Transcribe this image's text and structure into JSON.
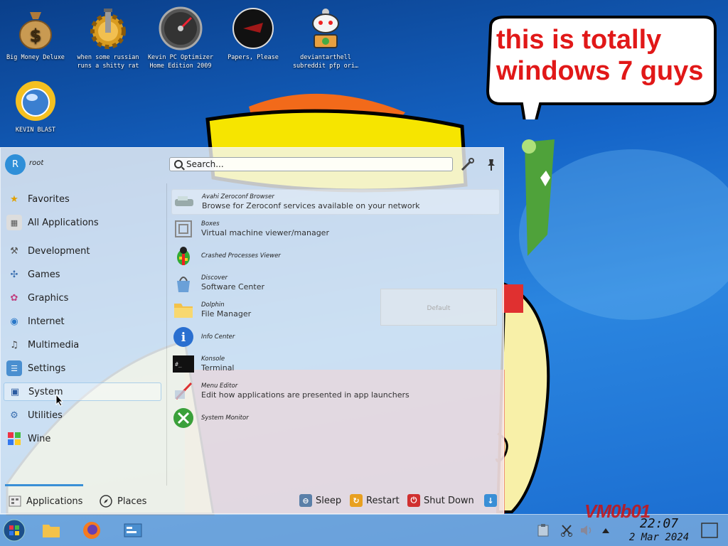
{
  "desktop": {
    "icons": [
      {
        "label": "Big Money Deluxe"
      },
      {
        "label": "when some russian runs a shitty rat"
      },
      {
        "label": "Kevin PC Optimizer Home Edition 2009"
      },
      {
        "label": "Papers, Please"
      },
      {
        "label": "deviantarthell subreddit pfp ori…"
      },
      {
        "label": "KEVIN BLAST"
      }
    ],
    "bubble_text": "this is totally windows 7 guys",
    "watermark": "VM0b01"
  },
  "menu": {
    "user": {
      "initial": "R",
      "name": "root"
    },
    "search": {
      "placeholder": "Search..."
    },
    "categories": [
      {
        "label": "Favorites",
        "icon": "star-icon"
      },
      {
        "label": "All Applications",
        "icon": "grid-icon"
      },
      {
        "label": "Development",
        "icon": "development-icon"
      },
      {
        "label": "Games",
        "icon": "games-icon"
      },
      {
        "label": "Graphics",
        "icon": "graphics-icon"
      },
      {
        "label": "Internet",
        "icon": "globe-icon"
      },
      {
        "label": "Multimedia",
        "icon": "multimedia-icon"
      },
      {
        "label": "Settings",
        "icon": "settings-icon"
      },
      {
        "label": "System",
        "icon": "system-icon",
        "selected": true
      },
      {
        "label": "Utilities",
        "icon": "utilities-icon"
      },
      {
        "label": "Wine",
        "icon": "wine-icon"
      }
    ],
    "apps": [
      {
        "name": "Avahi Zeroconf Browser",
        "desc": "Browse for Zeroconf services available on your network"
      },
      {
        "name": "Boxes",
        "desc": "Virtual machine viewer/manager"
      },
      {
        "name": "Crashed Processes Viewer",
        "desc": ""
      },
      {
        "name": "Discover",
        "desc": "Software Center"
      },
      {
        "name": "Dolphin",
        "desc": "File Manager"
      },
      {
        "name": "Info Center",
        "desc": ""
      },
      {
        "name": "Konsole",
        "desc": "Terminal"
      },
      {
        "name": "Menu Editor",
        "desc": "Edit how applications are presented in app launchers"
      },
      {
        "name": "System Monitor",
        "desc": ""
      }
    ],
    "ghost_label": "Default",
    "tabs": {
      "applications": "Applications",
      "places": "Places"
    },
    "power": {
      "sleep": "Sleep",
      "restart": "Restart",
      "shutdown": "Shut Down"
    }
  },
  "taskbar": {
    "time": "22:07",
    "date": "2 Mar 2024"
  },
  "colors": {
    "accent": "#3a8fd6",
    "bubble_text": "#e11818",
    "desktop_blue": "#1565c8"
  }
}
